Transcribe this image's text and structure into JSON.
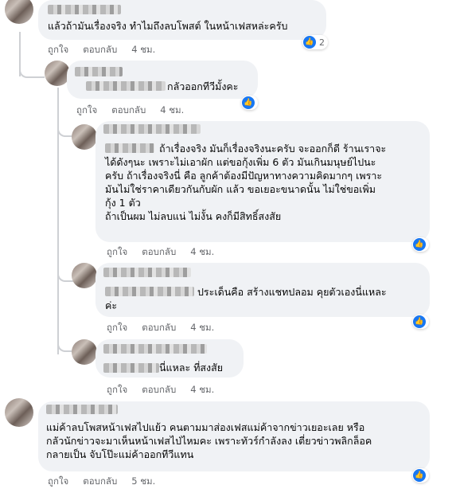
{
  "comments": [
    {
      "text": "แล้วถ้ามันเรื่องจริง ทำไมถึงลบโพสต์ ในหน้าเฟสหล่ะครับ",
      "like_label": "ถูกใจ",
      "reply_label": "ตอบกลับ",
      "time": "4 ชม.",
      "reaction_count": "2"
    },
    {
      "text": "กลัวออกทีวีมั้งคะ",
      "like_label": "ถูกใจ",
      "reply_label": "ตอบกลับ",
      "time": "4 ชม."
    },
    {
      "text": "ถ้าเรื่องจริง มันก็เรื่องจริงนะครับ จะออกก็ดี ร้านเราจะ\nได้ดังๆนะ เพราะไม่เอาผัก แต่ขอกุ้งเพิ่ม 6 ตัว มันเกินมนุษย์ไปนะ\nครับ ถ้าเรื่องจริงนี่ คือ ลูกค้าต้องมีปัญหาทางความคิดมากๆ เพราะ\nมันไม่ใช่ราคาเดียวกันกับผัก แล้ว ขอเยอะขนาดนั้น ไม่ใช่ขอเพิ่ม\nกุ้ง 1 ตัว\nถ้าเป็นผม ไม่ลบแน่ ไม่งั้น คงก็มีสิทธิ์สงสัย",
      "like_label": "ถูกใจ",
      "reply_label": "ตอบกลับ",
      "time": "4 ชม."
    },
    {
      "text": "ประเด็นคือ สร้างแชทปลอม คุยตัวเองนี่แหละ\nค่ะ",
      "like_label": "ถูกใจ",
      "reply_label": "ตอบกลับ",
      "time": "4 ชม."
    },
    {
      "text": "นี่แหละ ที่สงสัย",
      "like_label": "ถูกใจ",
      "reply_label": "ตอบกลับ",
      "time": "4 ชม."
    },
    {
      "text": "แม่ค้าลบโพสหน้าเฟสไปแย้ว คนตามมาส่องเฟสแม่ค้าจากข่าวเยอะเลย หรือ\nกลัวนักข่าวจะมาเห็นหน้าเฟสไป่ไหมคะ เพราะทัวร์กำลังลง เตี่ยวข่าวพลิกล็อค\nกลายเป็น จับโป๊ะแม่ค้าออกทีวีแทน",
      "like_label": "ถูกใจ",
      "reply_label": "ตอบกลับ",
      "time": "5 ชม."
    }
  ]
}
